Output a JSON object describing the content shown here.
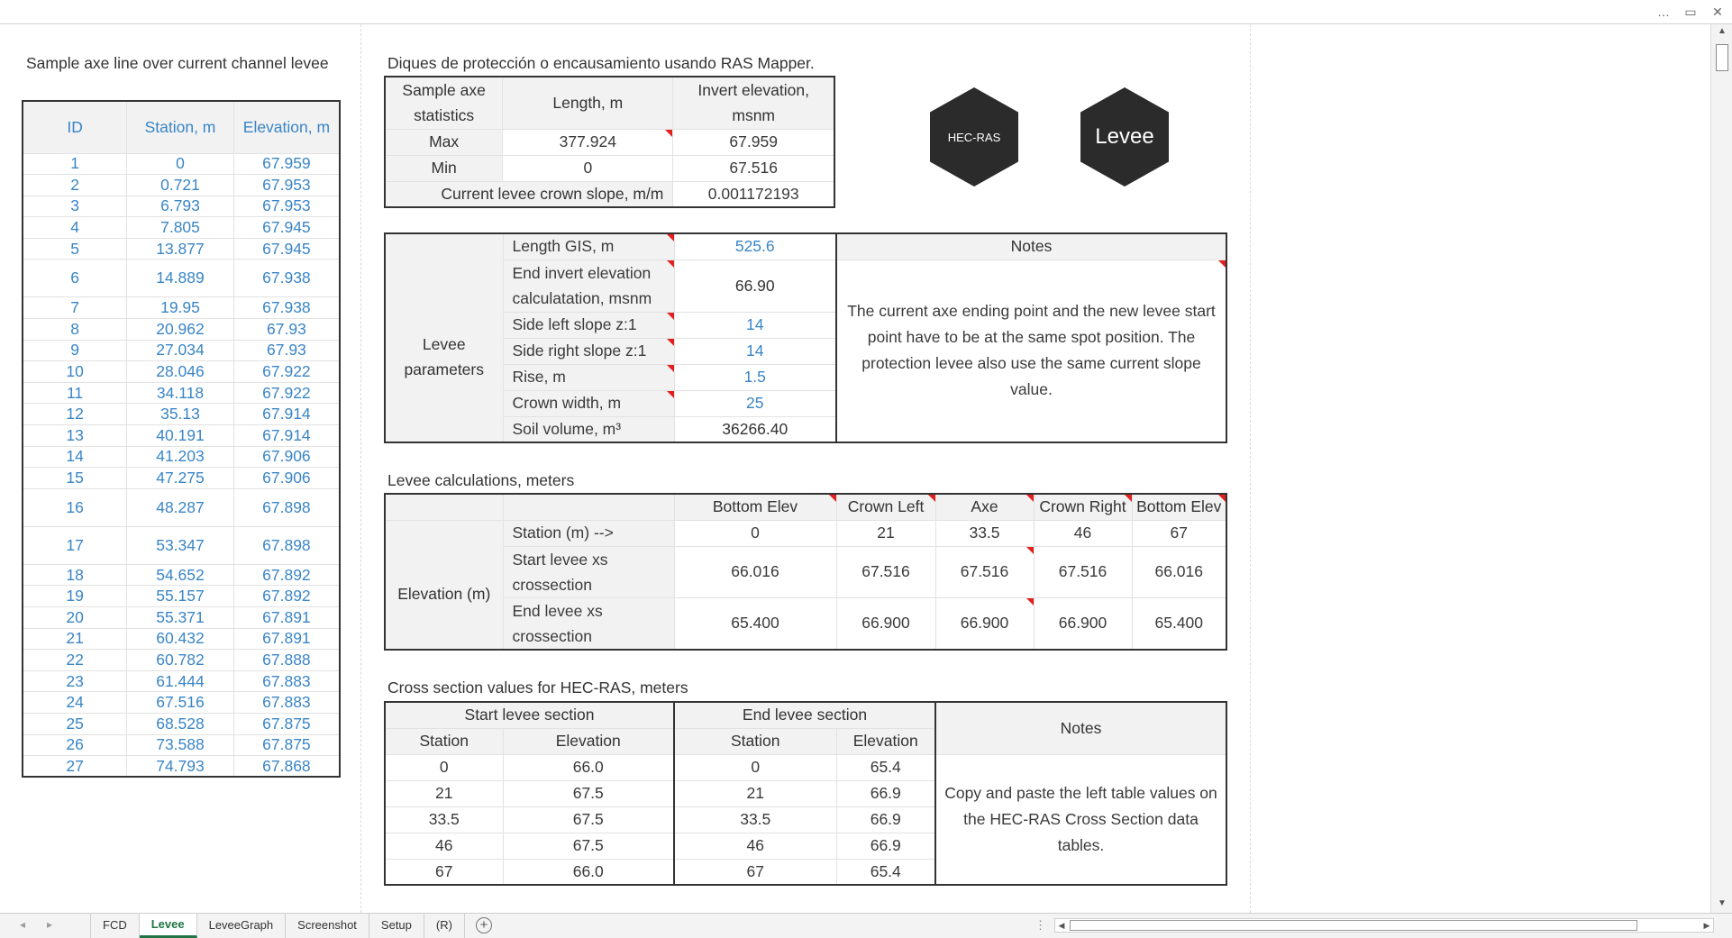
{
  "window": {
    "more_icon": "…",
    "restore_icon": "▭",
    "close_icon": "✕"
  },
  "ids": {
    "caption": "Sample axe line over current channel levee",
    "headers": [
      "ID",
      "Station, m",
      "Elevation, m"
    ],
    "rows": [
      [
        "1",
        "0",
        "67.959"
      ],
      [
        "2",
        "0.721",
        "67.953"
      ],
      [
        "3",
        "6.793",
        "67.953"
      ],
      [
        "4",
        "7.805",
        "67.945"
      ],
      [
        "5",
        "13.877",
        "67.945"
      ],
      [
        "6",
        "14.889",
        "67.938"
      ],
      [
        "7",
        "19.95",
        "67.938"
      ],
      [
        "8",
        "20.962",
        "67.93"
      ],
      [
        "9",
        "27.034",
        "67.93"
      ],
      [
        "10",
        "28.046",
        "67.922"
      ],
      [
        "11",
        "34.118",
        "67.922"
      ],
      [
        "12",
        "35.13",
        "67.914"
      ],
      [
        "13",
        "40.191",
        "67.914"
      ],
      [
        "14",
        "41.203",
        "67.906"
      ],
      [
        "15",
        "47.275",
        "67.906"
      ],
      [
        "16",
        "48.287",
        "67.898"
      ],
      [
        "17",
        "53.347",
        "67.898"
      ],
      [
        "18",
        "54.652",
        "67.892"
      ],
      [
        "19",
        "55.157",
        "67.892"
      ],
      [
        "20",
        "55.371",
        "67.891"
      ],
      [
        "21",
        "60.432",
        "67.891"
      ],
      [
        "22",
        "60.782",
        "67.888"
      ],
      [
        "23",
        "61.444",
        "67.883"
      ],
      [
        "24",
        "67.516",
        "67.883"
      ],
      [
        "25",
        "68.528",
        "67.875"
      ],
      [
        "26",
        "73.588",
        "67.875"
      ],
      [
        "27",
        "74.793",
        "67.868"
      ]
    ]
  },
  "stats": {
    "caption": "Diques de protección o encausamiento usando RAS Mapper.",
    "h1a": "Sample axe",
    "h1b": "statistics",
    "h2": "Length, m",
    "h3a": "Invert elevation,",
    "h3b": "msnm",
    "max_label": "Max",
    "max_len": "377.924",
    "max_elev": "67.959",
    "min_label": "Min",
    "min_len": "0",
    "min_elev": "67.516",
    "slope_label": "Current levee crown slope, m/m",
    "slope_value": "0.001172193"
  },
  "badges": {
    "hecras": "HEC-RAS",
    "levee": "Levee"
  },
  "params": {
    "group_label_1": "Levee",
    "group_label_2": "parameters",
    "length_label": "Length GIS, m",
    "length_value": "525.6",
    "endinv_label_1": "End invert elevation",
    "endinv_label_2": "calculatation, msnm",
    "endinv_value": "66.90",
    "sideleft_label": "Side left slope z:1",
    "sideleft_value": "14",
    "sideright_label": "Side right slope z:1",
    "sideright_value": "14",
    "rise_label": "Rise, m",
    "rise_value": "1.5",
    "crown_label": "Crown width, m",
    "crown_value": "25",
    "soil_label": "Soil volume, m³",
    "soil_value": "36266.40",
    "notes_header": "Notes",
    "notes_line1": "The current axe ending point and the new levee start",
    "notes_line2": "point have to be at the same spot position. The",
    "notes_line3": "protection levee also use the same current slope",
    "notes_line4": "value."
  },
  "calcs": {
    "caption": "Levee calculations, meters",
    "cols": [
      "Bottom Elev",
      "Crown Left",
      "Axe",
      "Crown Right",
      "Bottom Elev"
    ],
    "station_label": "Station (m) -->",
    "stations": [
      "0",
      "21",
      "33.5",
      "46",
      "67"
    ],
    "elev_label": "Elevation (m)",
    "start_label_1": "Start levee xs",
    "start_label_2": "crossection",
    "start_values": [
      "66.016",
      "67.516",
      "67.516",
      "67.516",
      "66.016"
    ],
    "end_label_1": "End levee xs",
    "end_label_2": "crossection",
    "end_values": [
      "65.400",
      "66.900",
      "66.900",
      "66.900",
      "65.400"
    ]
  },
  "xs": {
    "caption": "Cross section values for HEC-RAS, meters",
    "start_header": "Start levee section",
    "end_header": "End levee section",
    "notes_header": "Notes",
    "station": "Station",
    "elevation": "Elevation",
    "rows": [
      [
        "0",
        "66.0",
        "0",
        "65.4"
      ],
      [
        "21",
        "67.5",
        "21",
        "66.9"
      ],
      [
        "33.5",
        "67.5",
        "33.5",
        "66.9"
      ],
      [
        "46",
        "67.5",
        "46",
        "66.9"
      ],
      [
        "67",
        "66.0",
        "67",
        "65.4"
      ]
    ],
    "notes_line1": "Copy and paste the left table values on",
    "notes_line2": "the HEC-RAS Cross Section data tables."
  },
  "tabs": {
    "prev": "◂",
    "next": "▸",
    "items": [
      "FCD",
      "Levee",
      "LeveeGraph",
      "Screenshot",
      "Setup",
      "(R)"
    ],
    "active": "Levee",
    "add": "+",
    "dots": "⋮"
  }
}
